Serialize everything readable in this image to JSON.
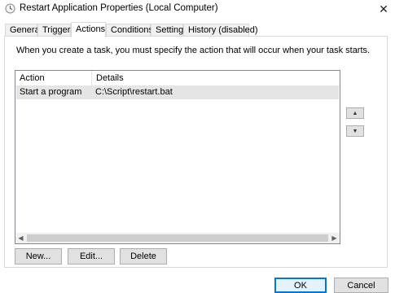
{
  "window": {
    "title": "Restart Application Properties (Local Computer)",
    "close_glyph": "✕"
  },
  "tabs": [
    {
      "label": "General"
    },
    {
      "label": "Triggers"
    },
    {
      "label": "Actions"
    },
    {
      "label": "Conditions"
    },
    {
      "label": "Settings"
    },
    {
      "label": "History (disabled)"
    }
  ],
  "actions_tab": {
    "description": "When you create a task, you must specify the action that will occur when your task starts.",
    "columns": [
      "Action",
      "Details"
    ],
    "rows": [
      {
        "action": "Start a program",
        "details": "C:\\Script\\restart.bat"
      }
    ],
    "buttons": {
      "new": "New...",
      "edit": "Edit...",
      "delete": "Delete"
    }
  },
  "dialog_buttons": {
    "ok": "OK",
    "cancel": "Cancel"
  },
  "colors": {
    "accent": "#0078d7",
    "selection": "#e5e5e5",
    "button_face": "#e1e1e1"
  }
}
